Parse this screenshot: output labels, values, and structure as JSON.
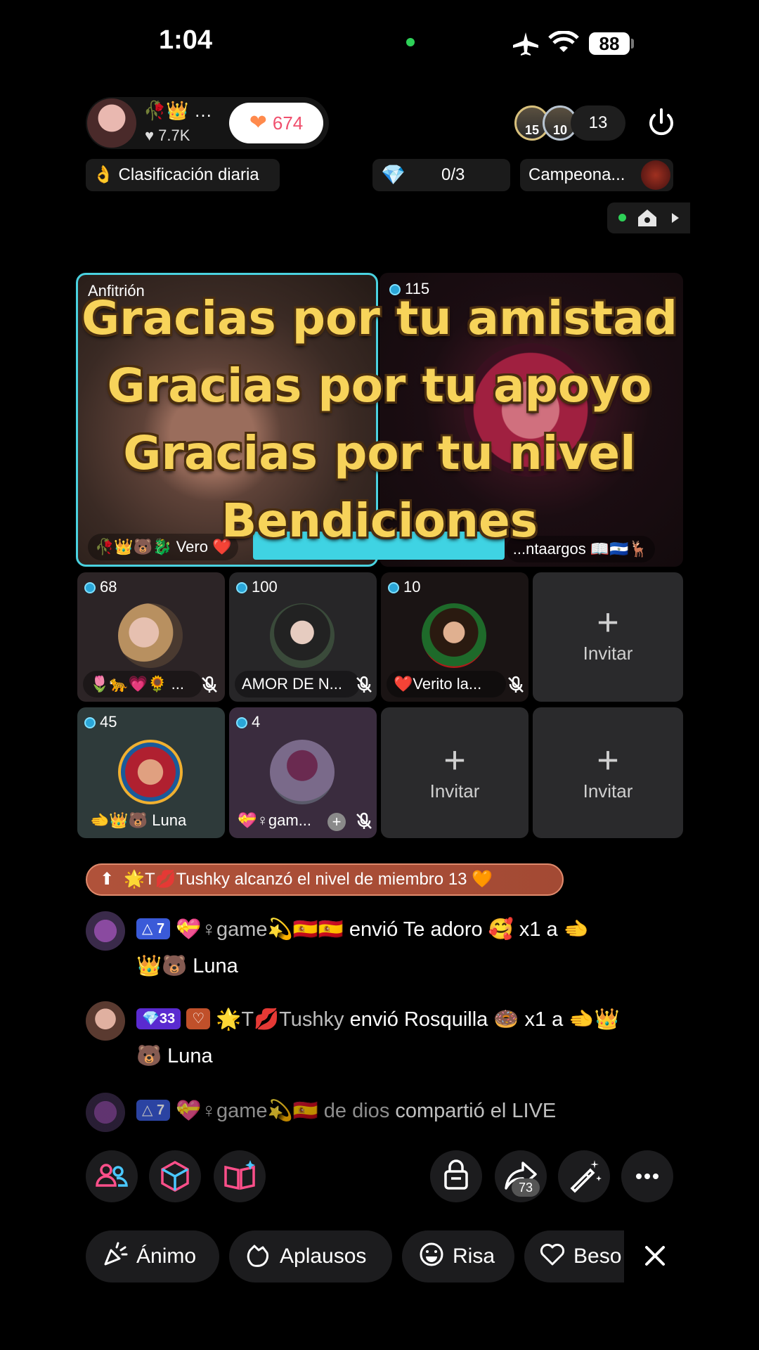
{
  "status_bar": {
    "time": "1:04",
    "battery": "88"
  },
  "host": {
    "emojis": "🥀👑 …",
    "likes": "♥ 7.7K",
    "heart_count": "674"
  },
  "viewers": {
    "avatar1_level": "15",
    "avatar2_level": "10",
    "count": "13"
  },
  "chips": {
    "daily_rank": "👌 Clasificación diaria",
    "task_progress": "0/3",
    "championship": "Campeona..."
  },
  "host_tile": {
    "label": "Anfitrión",
    "name": "🥀👑🐻🐉 Vero ❤️"
  },
  "guest_main": {
    "score": "115",
    "name": "...ntaargos 📖🇸🇻🦌"
  },
  "overlay_lines": [
    "Gracias por tu amistad",
    "Gracias por tu apoyo",
    "Gracias por tu nivel",
    "Bendiciones"
  ],
  "guests": [
    {
      "score": "68",
      "name": "🌷🐆💗🌻 ..."
    },
    {
      "score": "100",
      "name": "AMOR DE N..."
    },
    {
      "score": "10",
      "name": "❤️Verito la..."
    },
    {
      "score": "45",
      "name": "🫲👑🐻 Luna"
    },
    {
      "score": "4",
      "name": "💝♀gam..."
    }
  ],
  "invite_label": "Invitar",
  "banner": "🌟T💋Tushky alcanzó el nivel de miembro 13 🧡",
  "chat": [
    {
      "level": "7",
      "user": "💝♀game💫🇪🇸🇪🇸",
      "text": " envió Te adoro 🥰 x1 a 🫲",
      "cont": "👑🐻 Luna"
    },
    {
      "level": "33",
      "user": "🌟T💋Tushky",
      "text": " envió Rosquilla 🍩 x1 a 🫲👑",
      "cont": "🐻 Luna"
    },
    {
      "level": "7",
      "user": "💝♀game💫🇪🇸 de dios",
      "text": " compartió el LIVE"
    }
  ],
  "toolbar": {
    "share_count": "73"
  },
  "reactions": [
    "Ánimo",
    "Aplausos",
    "Risa",
    "Beso"
  ],
  "colors": {
    "accent_cyan": "#4ad2e0",
    "heart": "#f0506e",
    "overlay_gold": "#f7d35a",
    "banner": "#b0523a"
  }
}
